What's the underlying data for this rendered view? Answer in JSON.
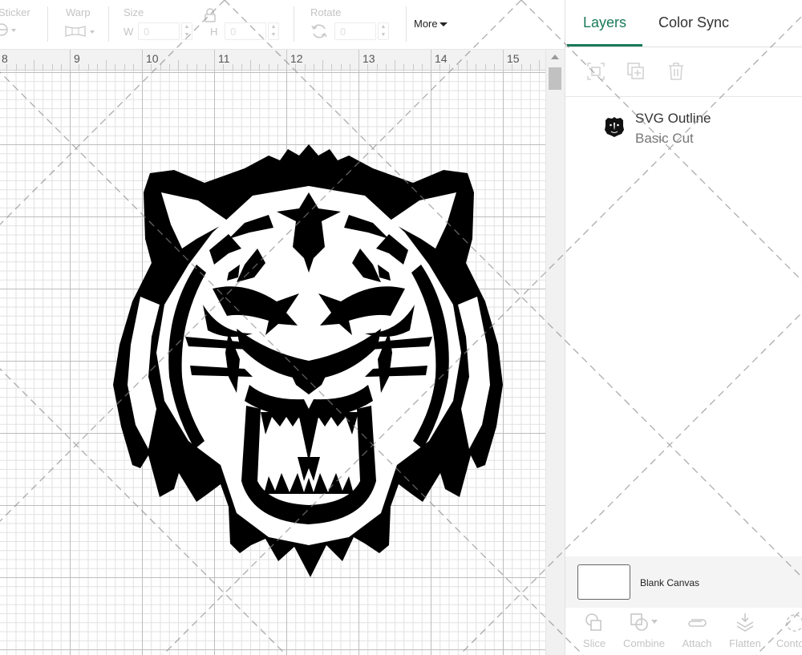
{
  "toolbar": {
    "sticker_label": "Sticker",
    "warp_label": "Warp",
    "size_label": "Size",
    "width_label": "W",
    "width_value": "0",
    "height_label": "H",
    "height_value": "0",
    "rotate_label": "Rotate",
    "rotate_value": "0",
    "more_label": "More"
  },
  "ruler": {
    "ticks": [
      "8",
      "9",
      "10",
      "11",
      "12",
      "13",
      "14",
      "15"
    ]
  },
  "panel": {
    "tabs": [
      {
        "label": "Layers",
        "active": true
      },
      {
        "label": "Color Sync",
        "active": false
      }
    ],
    "layer_tools": [
      "group-icon",
      "duplicate-icon",
      "delete-icon"
    ],
    "layers": [
      {
        "name": "SVG Outline",
        "operation": "Basic Cut",
        "icon": "tiger-thumbnail-icon"
      }
    ],
    "blank_canvas_label": "Blank Canvas",
    "bottom_tools": [
      {
        "label": "Slice",
        "icon": "slice-icon"
      },
      {
        "label": "Combine",
        "icon": "combine-icon"
      },
      {
        "label": "Attach",
        "icon": "attach-icon"
      },
      {
        "label": "Flatten",
        "icon": "flatten-icon"
      },
      {
        "label": "Contour",
        "icon": "contour-icon"
      }
    ]
  },
  "canvas": {
    "design": "tiger-head-svg"
  },
  "colors": {
    "accent": "#1a7a5a",
    "design_fill": "#000000",
    "grid_major": "#bdbdbd",
    "grid_minor": "#e1e1e1"
  }
}
